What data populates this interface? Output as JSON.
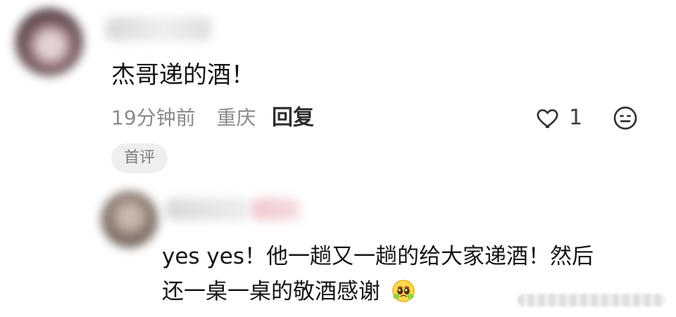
{
  "comment": {
    "text": "杰哥递的酒！",
    "time": "19分钟前",
    "location": "重庆",
    "reply_label": "回复",
    "like_count": "1",
    "badge": "首评"
  },
  "reply": {
    "line1": "yes yes！他一趟又一趟的给大家递酒！然后",
    "line2": "还一桌一桌的敬酒感谢"
  },
  "icons": {
    "like": "heart-outline-icon",
    "emoji": "smiley-icon",
    "reply_emoji": "pleading-face-emoji"
  },
  "colors": {
    "text_primary": "#151515",
    "text_secondary": "#8a8a8a",
    "badge_bg": "#efefef",
    "badge_text": "#7c7c7c"
  }
}
